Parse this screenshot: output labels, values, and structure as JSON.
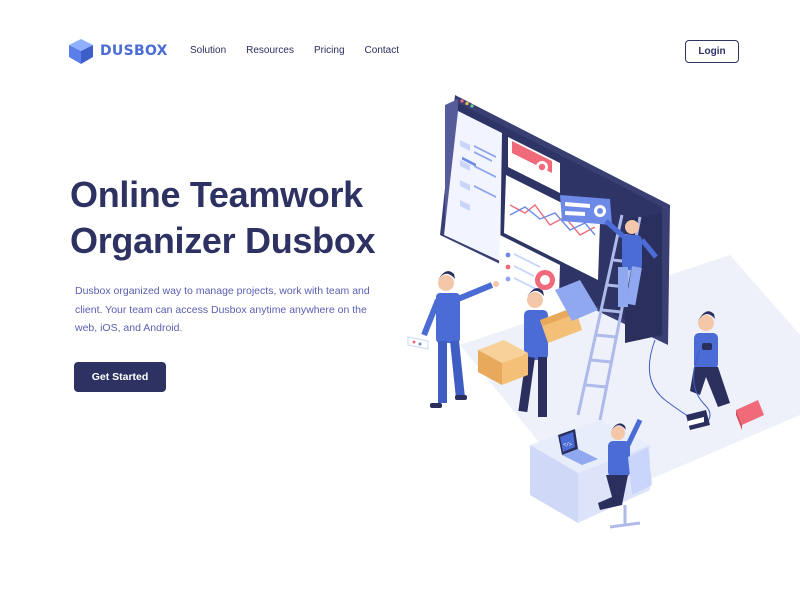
{
  "brand": {
    "name": "DUSBOX"
  },
  "nav": {
    "items": [
      {
        "label": "Solution"
      },
      {
        "label": "Resources"
      },
      {
        "label": "Pricing"
      },
      {
        "label": "Contact"
      }
    ],
    "login_label": "Login"
  },
  "hero": {
    "title_line1": "Online Teamwork",
    "title_line2": "Organizer Dusbox",
    "description": "Dusbox organized way to manage projects, work with team and client. Your team can access Dusbox anytime anywhere on the web, iOS, and Android.",
    "cta_label": "Get Started"
  },
  "colors": {
    "primary_dark": "#2e3262",
    "brand_blue": "#4a6cd4",
    "text_muted": "#5a5fb0",
    "accent_red": "#f06a7a"
  }
}
